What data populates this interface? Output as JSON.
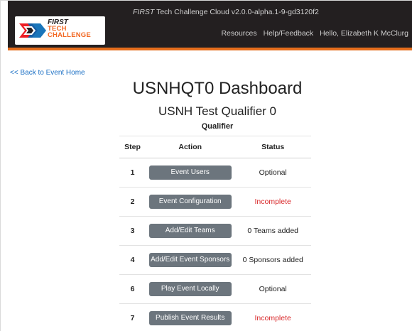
{
  "header": {
    "version_brand": "FIRST",
    "version_rest": " Tech Challenge Cloud v2.0.0-alpha.1-9-gd3120f2",
    "logo": {
      "first": "FIRST",
      "tech": "TECH",
      "challenge": "CHALLENGE"
    },
    "nav": {
      "resources": "Resources",
      "help": "Help/Feedback",
      "user": "Hello, Elizabeth K McClurg"
    }
  },
  "back_link": "<< Back to Event Home",
  "page": {
    "title": "USNHQT0 Dashboard",
    "subtitle": "USNH Test Qualifier 0",
    "event_type": "Qualifier"
  },
  "table": {
    "headers": {
      "step": "Step",
      "action": "Action",
      "status": "Status"
    },
    "rows": [
      {
        "step": "1",
        "action": "Event Users",
        "status": "Optional",
        "status_state": "neutral"
      },
      {
        "step": "2",
        "action": "Event Configuration",
        "status": "Incomplete",
        "status_state": "incomplete"
      },
      {
        "step": "3",
        "action": "Add/Edit Teams",
        "status": "0 Teams added",
        "status_state": "neutral"
      },
      {
        "step": "4",
        "action": "Add/Edit Event Sponsors",
        "status": "0 Sponsors added",
        "status_state": "neutral"
      },
      {
        "step": "6",
        "action": "Play Event Locally",
        "status": "Optional",
        "status_state": "neutral"
      },
      {
        "step": "7",
        "action": "Publish Event Results",
        "status": "Incomplete",
        "status_state": "incomplete"
      }
    ]
  },
  "colors": {
    "navbar_bg": "#231f20",
    "navbar_accent": "#e46d1c",
    "button_bg": "#6c757d",
    "incomplete": "#d9292b",
    "link": "#1a6fc4"
  }
}
